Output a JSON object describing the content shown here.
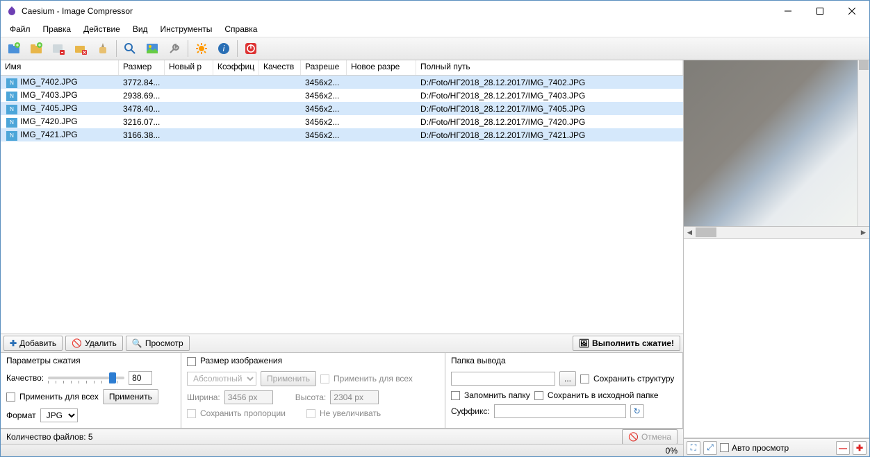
{
  "window": {
    "title": "Caesium - Image Compressor"
  },
  "menu": [
    "Файл",
    "Правка",
    "Действие",
    "Вид",
    "Инструменты",
    "Справка"
  ],
  "toolbar_icons": [
    "add-file-icon",
    "add-folder-icon",
    "remove-icon",
    "remove-all-icon",
    "clear-icon",
    "separator",
    "search-icon",
    "picture-icon",
    "tools-icon",
    "separator",
    "settings-gear-icon",
    "info-icon",
    "separator",
    "power-icon"
  ],
  "columns": {
    "name": "Имя",
    "size": "Размер",
    "newsize": "Новый р",
    "ratio": "Коэффиц",
    "quality": "Качеств",
    "res": "Разреше",
    "newres": "Новое разре",
    "path": "Полный путь"
  },
  "rows": [
    {
      "name": "IMG_7402.JPG",
      "size": "3772.84...",
      "res": "3456x2...",
      "path": "D:/Foto/НГ2018_28.12.2017/IMG_7402.JPG"
    },
    {
      "name": "IMG_7403.JPG",
      "size": "2938.69...",
      "res": "3456x2...",
      "path": "D:/Foto/НГ2018_28.12.2017/IMG_7403.JPG"
    },
    {
      "name": "IMG_7405.JPG",
      "size": "3478.40...",
      "res": "3456x2...",
      "path": "D:/Foto/НГ2018_28.12.2017/IMG_7405.JPG"
    },
    {
      "name": "IMG_7420.JPG",
      "size": "3216.07...",
      "res": "3456x2...",
      "path": "D:/Foto/НГ2018_28.12.2017/IMG_7420.JPG"
    },
    {
      "name": "IMG_7421.JPG",
      "size": "3166.38...",
      "res": "3456x2...",
      "path": "D:/Foto/НГ2018_28.12.2017/IMG_7421.JPG"
    }
  ],
  "actions": {
    "add": "Добавить",
    "remove": "Удалить",
    "preview": "Просмотр",
    "compress": "Выполнить сжатие!"
  },
  "compress_panel": {
    "title": "Параметры сжатия",
    "quality_label": "Качество:",
    "quality_value": "80",
    "apply_all": "Применить для всех",
    "apply": "Применить",
    "format_label": "Формат",
    "format_value": "JPG"
  },
  "resize_panel": {
    "title": "Размер изображения",
    "mode": "Абсолютный",
    "apply": "Применить",
    "apply_all": "Применить для всех",
    "width_label": "Ширина:",
    "width_value": "3456 px",
    "height_label": "Высота:",
    "height_value": "2304 px",
    "keep_ratio": "Сохранить пропорции",
    "no_enlarge": "Не увеличивать"
  },
  "output_panel": {
    "title": "Папка вывода",
    "browse": "...",
    "keep_structure": "Сохранить структуру",
    "remember": "Запомнить папку",
    "same_folder": "Сохранить в исходной папке",
    "suffix_label": "Суффикс:"
  },
  "status": {
    "count": "Количество файлов: 5",
    "cancel": "Отмена",
    "progress": "0%"
  },
  "preview_footer": {
    "auto": "Авто просмотр"
  }
}
